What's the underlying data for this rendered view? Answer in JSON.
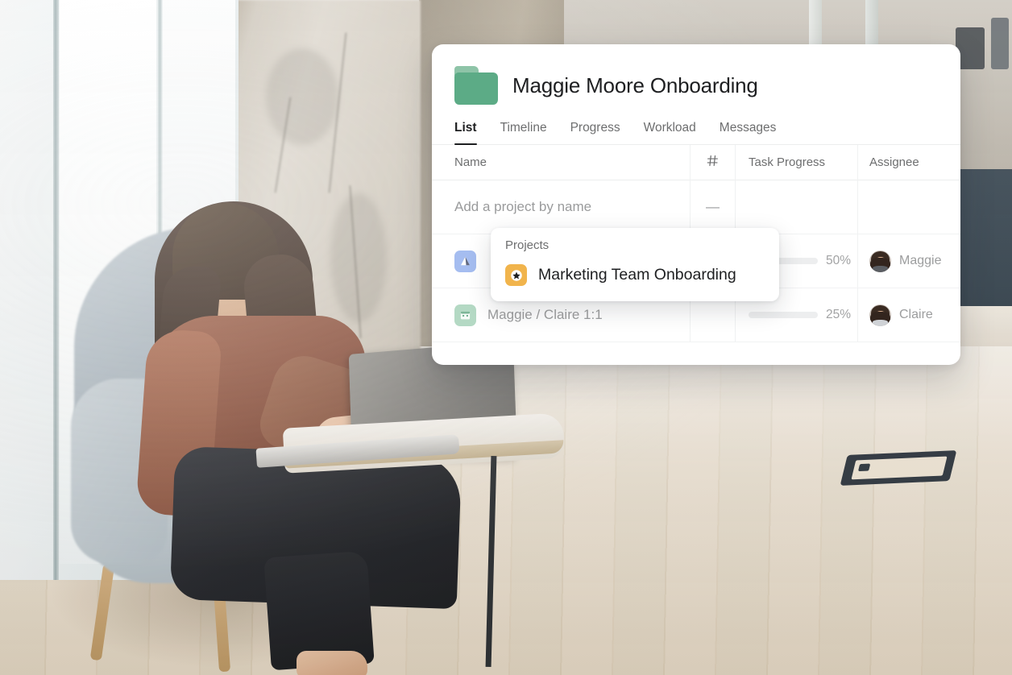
{
  "background": {
    "description": "Photo of a woman working on a laptop in a modern office lounge",
    "alt": "woman-at-laptop-office-photo"
  },
  "card": {
    "folder_icon": "folder-icon",
    "title": "Maggie Moore Onboarding",
    "tabs": [
      {
        "label": "List",
        "active": true
      },
      {
        "label": "Timeline",
        "active": false
      },
      {
        "label": "Progress",
        "active": false
      },
      {
        "label": "Workload",
        "active": false
      },
      {
        "label": "Messages",
        "active": false
      }
    ],
    "table": {
      "columns": [
        {
          "key": "name",
          "label": "Name"
        },
        {
          "key": "hash",
          "label": "#"
        },
        {
          "key": "progress",
          "label": "Task Progress"
        },
        {
          "key": "assignee",
          "label": "Assignee"
        }
      ],
      "add_row": {
        "placeholder": "Add a project by name",
        "hash_value": "—"
      },
      "rows": [
        {
          "icon": "mountain-icon",
          "icon_color": "#a5bdf0",
          "name": "",
          "hash": "",
          "progress_pct": 50,
          "progress_label": "50%",
          "assignee": "Maggie"
        },
        {
          "icon": "calendar-icon",
          "icon_color": "#b4d9c4",
          "name": "Maggie / Claire 1:1",
          "hash": "",
          "progress_pct": 25,
          "progress_label": "25%",
          "assignee": "Claire"
        }
      ]
    }
  },
  "dropdown": {
    "section_title": "Projects",
    "items": [
      {
        "icon": "star-icon",
        "icon_color": "#f1b44c",
        "label": "Marketing Team Onboarding"
      }
    ]
  },
  "colors": {
    "accent_green": "#5cab86",
    "progress_fill": "#7cc49b",
    "star_badge": "#f1b44c",
    "text_primary": "#1e1f21",
    "text_muted": "#6d6e6f",
    "card_bg": "#ffffff"
  }
}
